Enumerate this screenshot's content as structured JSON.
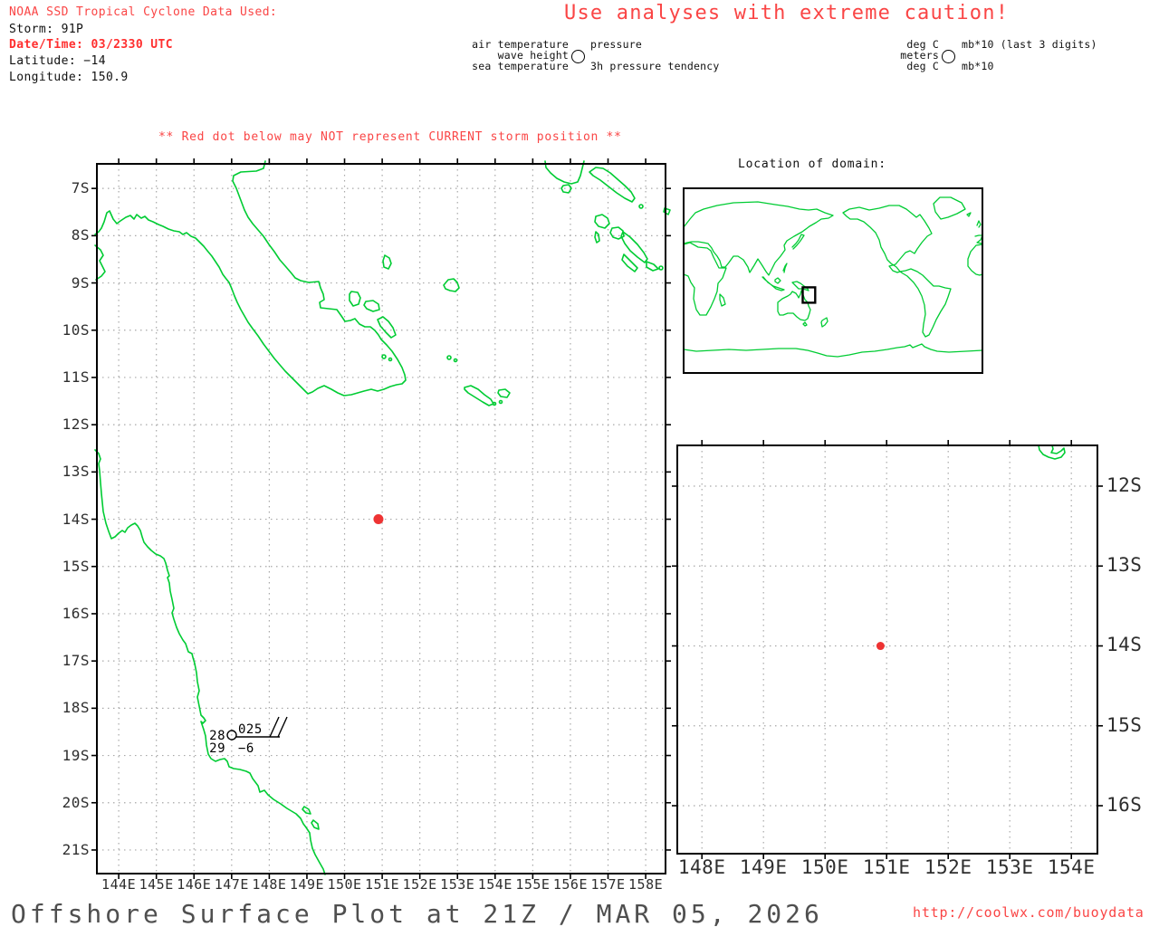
{
  "colors": {
    "red_text": "#fa4545",
    "red_bold": "#ff2e2e",
    "storm_dot": "#ee3333",
    "coastline": "#00cc33",
    "grid": "#a8a8a8",
    "tick_label": "#2e2e2e",
    "title_gray": "#4f4f4f"
  },
  "header": {
    "noaa_line": "NOAA SSD Tropical Cyclone Data Used:",
    "storm": "Storm: 91P",
    "datetime": "Date/Time: 03/2330 UTC",
    "latitude": "Latitude: −14",
    "longitude": "Longitude: 150.9",
    "caution": "Use analyses with extreme caution!"
  },
  "legend_center": {
    "row1_left": "air temperature",
    "row1_right": "pressure",
    "row2_left": "wave height",
    "row3_left": "sea temperature",
    "row3_right": "3h pressure tendency",
    "circle_icon": "station-circle"
  },
  "legend_right": {
    "row1_left": "deg C",
    "row1_right": "mb*10 (last 3 digits)",
    "row2_left": "meters",
    "row3_left": "deg C",
    "row3_right": "mb*10",
    "circle_icon": "station-circle"
  },
  "warning": "** Red dot below may NOT represent CURRENT storm position **",
  "inset": {
    "title": "Location of domain:"
  },
  "main_map": {
    "x_tick_labels": [
      "144E",
      "145E",
      "146E",
      "147E",
      "148E",
      "149E",
      "150E",
      "151E",
      "152E",
      "153E",
      "154E",
      "155E",
      "156E",
      "157E",
      "158E"
    ],
    "y_tick_labels": [
      "7S",
      "8S",
      "9S",
      "10S",
      "11S",
      "12S",
      "13S",
      "14S",
      "15S",
      "16S",
      "17S",
      "18S",
      "19S",
      "20S",
      "21S"
    ],
    "station": {
      "air_temp": "28",
      "sea_temp": "29",
      "pressure": "025",
      "pressure_tendency": "−6"
    },
    "storm": {
      "lon": 150.9,
      "lat": -14
    }
  },
  "zoom_map": {
    "x_tick_labels": [
      "148E",
      "149E",
      "150E",
      "151E",
      "152E",
      "153E",
      "154E"
    ],
    "y_tick_labels": [
      "12S",
      "13S",
      "14S",
      "15S",
      "16S"
    ],
    "storm": {
      "lon": 150.9,
      "lat": -14
    }
  },
  "footer": {
    "title": "Offshore Surface Plot at 21Z / MAR 05, 2026",
    "url": "http://coolwx.com/buoydata"
  }
}
